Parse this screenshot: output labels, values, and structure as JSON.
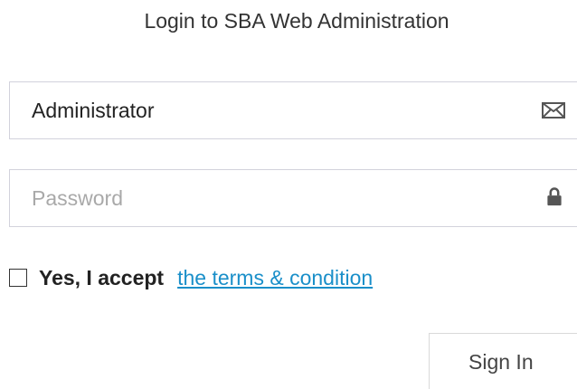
{
  "login": {
    "title": "Login to SBA Web Administration",
    "username_value": "Administrator",
    "username_icon": "envelope-icon",
    "password_value": "",
    "password_placeholder": "Password",
    "password_icon": "lock-icon",
    "terms_checked": false,
    "accept_label": "Yes, I accept",
    "terms_link": "the terms & condition",
    "sign_in_label": "Sign In"
  }
}
